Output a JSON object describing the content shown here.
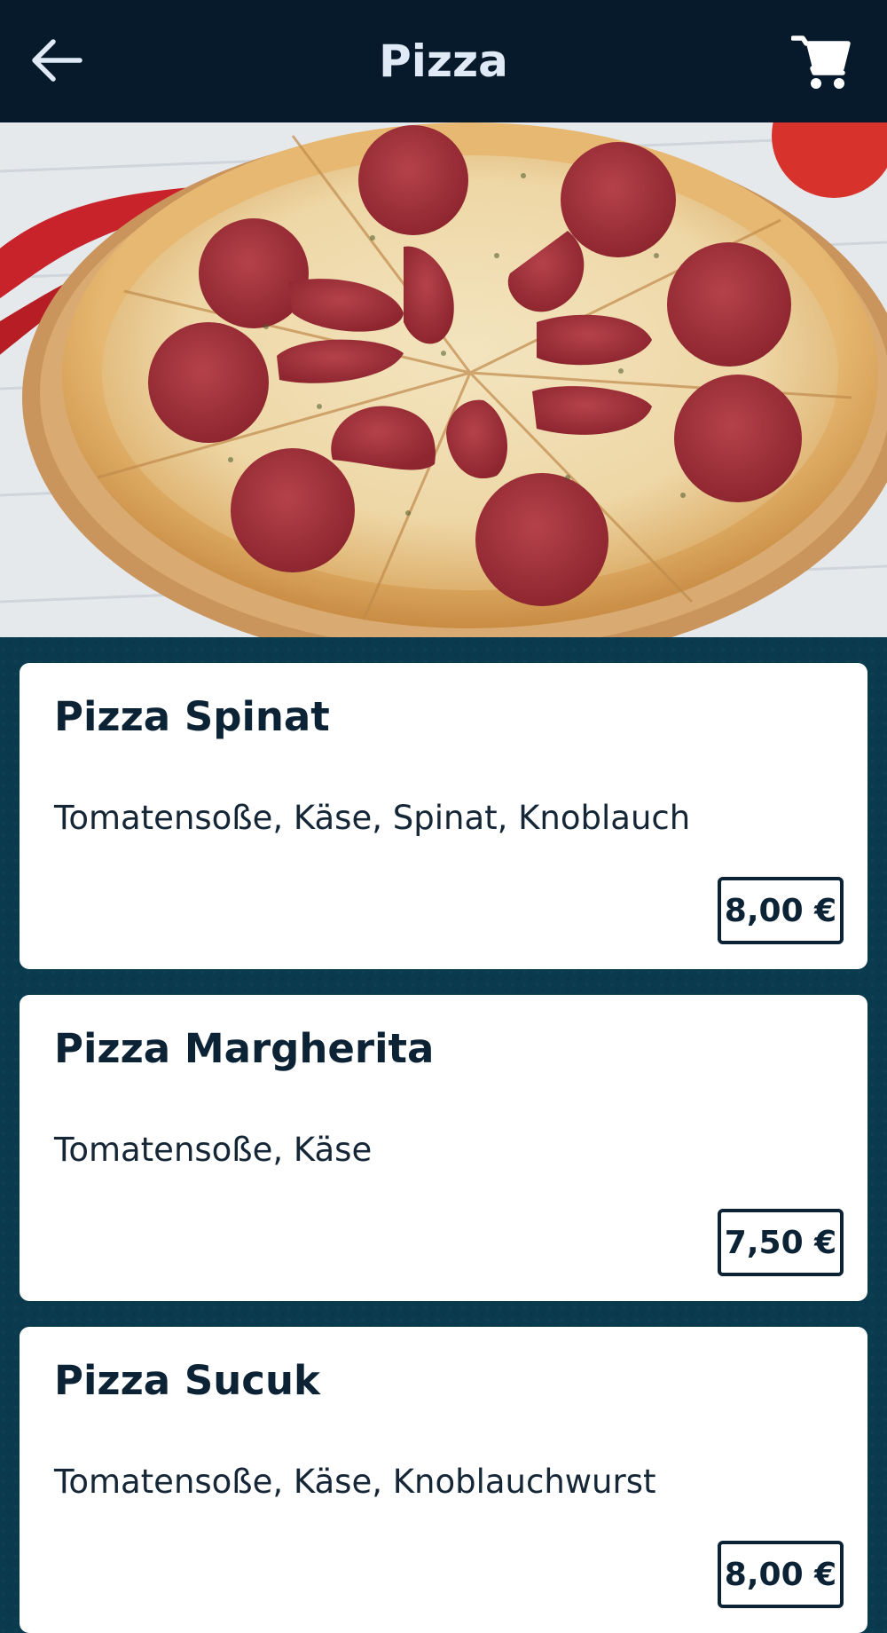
{
  "header": {
    "title": "Pizza",
    "back_icon": "arrow-left-icon",
    "cart_icon": "shopping-cart-icon"
  },
  "colors": {
    "appbar": "#061a2b",
    "background": "#0a3a4e",
    "card": "#ffffff",
    "text_dark": "#0c2336",
    "title_text": "#dfeaf6"
  },
  "menu": {
    "items": [
      {
        "name": "Pizza Spinat",
        "description": "Tomatensoße, Käse, Spinat, Knoblauch",
        "price": "8,00 €"
      },
      {
        "name": "Pizza Margherita",
        "description": "Tomatensoße, Käse",
        "price": "7,50 €"
      },
      {
        "name": "Pizza Sucuk",
        "description": "Tomatensoße, Käse, Knoblauchwurst",
        "price": "8,00 €"
      }
    ]
  }
}
